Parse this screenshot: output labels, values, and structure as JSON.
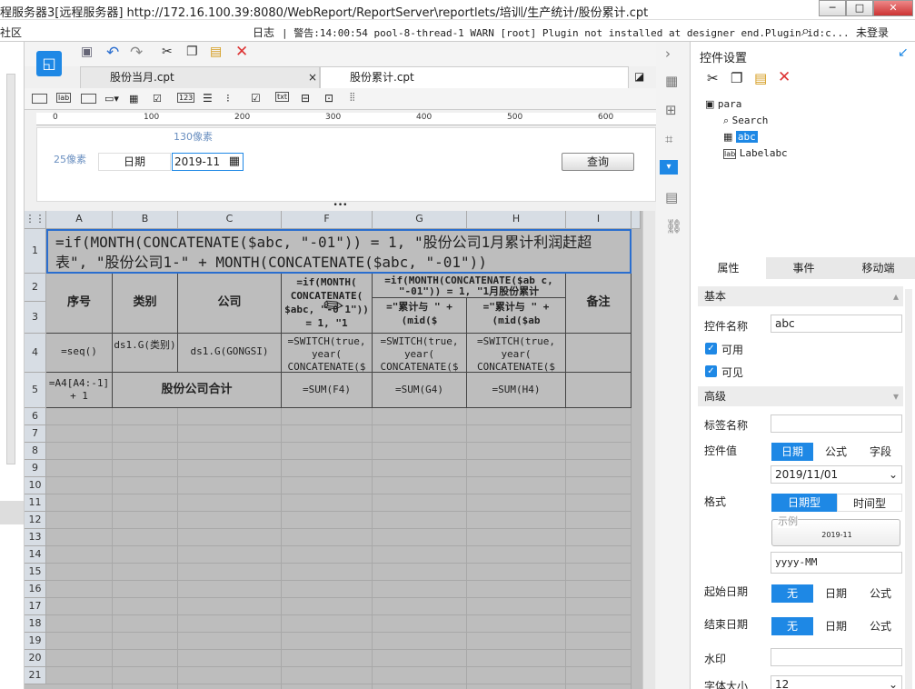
{
  "window": {
    "title": "程服务器3[远程服务器]   http://172.16.100.39:8080/WebReport/ReportServer\\reportlets/培训/生产统计/股份累计.cpt"
  },
  "menubar": {
    "left": "社区",
    "log": "日志",
    "warning": "| 警告:14:00:54 pool-8-thread-1 WARN [root] Plugin not installed at designer end.Plugin id:c...",
    "login": "未登录"
  },
  "tabs": [
    {
      "label": "股份当月.cpt"
    },
    {
      "label": "股份累计.cpt"
    }
  ],
  "ruler": {
    "ticks": [
      "0",
      "100",
      "200",
      "300",
      "400",
      "500",
      "600"
    ]
  },
  "canvas": {
    "w_label": "130像素",
    "h_label": "25像素",
    "date_label": "日期",
    "date_value": "2019-11",
    "query_button": "查询"
  },
  "sheet": {
    "columns": [
      "A",
      "B",
      "C",
      "F",
      "G",
      "H",
      "I"
    ],
    "rows": [
      "1",
      "2",
      "3",
      "4",
      "5",
      "6",
      "7",
      "8",
      "9",
      "10",
      "11",
      "12",
      "13",
      "14",
      "15",
      "16",
      "17",
      "18",
      "19",
      "20",
      "21"
    ],
    "r1": "=if(MONTH(CONCATENATE($abc, \"-01\")) = 1, \"股份公司1月累计利润赶超表\", \"股份公司1-\" + MONTH(CONCATENATE($abc, \"-01\"))",
    "h_seq": "序号",
    "h_type": "类别",
    "h_company": "公司",
    "h_f": "=if(MONTH( CONCATENATE( $abc, \"-0 1\")) = 1, \"1",
    "h_g_top": "=if(MONTH(CONCATENATE($ab c, \"-01\")) = 1, \"1月股份累计",
    "h_g": "=\"累计与 \" + (mid($",
    "h_h": "=\"累计与 \" + (mid($ab",
    "h_note": "备注",
    "r4a": "=seq()",
    "r4b": "ds1.G(类别)",
    "r4c": "ds1.G(GONGSI)",
    "r4f": "=SWITCH(true, year( CONCATENATE($",
    "r4g": "=SWITCH(true, year( CONCATENATE($",
    "r4h": "=SWITCH(true, year( CONCATENATE($",
    "r5a": "=A4[A4:-1] + 1",
    "r5b": "股份公司合计",
    "r5f": "=SUM(F4)",
    "r5g": "=SUM(G4)",
    "r5h": "=SUM(H4)"
  },
  "panel": {
    "title": "控件设置",
    "tree": [
      "para",
      "Search",
      "abc",
      "Labelabc"
    ],
    "tabs": [
      "属性",
      "事件",
      "移动端"
    ],
    "basic": "基本",
    "name_label": "控件名称",
    "name_value": "abc",
    "enabled": "可用",
    "visible": "可见",
    "advanced": "高级",
    "tag_label": "标签名称",
    "value_label": "控件值",
    "value_opts": [
      "日期",
      "公式",
      "字段"
    ],
    "value_date": "2019/11/01",
    "format_label": "格式",
    "format_opts": [
      "日期型",
      "时间型"
    ],
    "sample_label": "示例",
    "sample_value": "2019-11",
    "format_value": "yyyy-MM",
    "start_label": "起始日期",
    "end_label": "结束日期",
    "range_opts": [
      "无",
      "日期",
      "公式"
    ],
    "watermark_label": "水印",
    "fontsize_label": "字体大小",
    "fontsize_value": "12"
  }
}
